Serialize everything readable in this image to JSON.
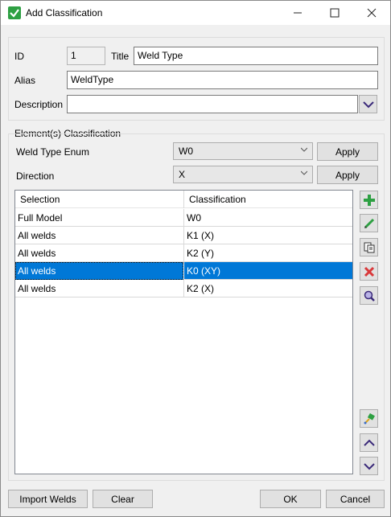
{
  "window": {
    "title": "Add Classification",
    "minimize_glyph": "—",
    "maximize_glyph": "☐",
    "close_glyph": "✕"
  },
  "header": {
    "id_label": "ID",
    "id_value": "1",
    "title_label": "Title",
    "title_value": "Weld Type",
    "alias_label": "Alias",
    "alias_value": "WeldType",
    "description_label": "Description",
    "description_value": ""
  },
  "classification": {
    "group_label": "Element(s) Classification",
    "enum_label": "Weld Type Enum",
    "enum_value": "W0",
    "direction_label": "Direction",
    "direction_value": "X",
    "apply_label": "Apply"
  },
  "table": {
    "columns": [
      "Selection",
      "Classification"
    ],
    "rows": [
      {
        "selection": "Full Model",
        "classification": "W0"
      },
      {
        "selection": "All welds",
        "classification": "K1 (X)"
      },
      {
        "selection": "All welds",
        "classification": "K2 (Y)"
      },
      {
        "selection": "All welds",
        "classification": "K0 (XY)"
      },
      {
        "selection": "All welds",
        "classification": "K2 (X)"
      }
    ],
    "selected_index": 3
  },
  "side_tools": [
    "add-icon",
    "edit-icon",
    "copy-icon",
    "delete-icon",
    "zoom-icon",
    "paint-icon",
    "move-up-icon",
    "move-down-icon"
  ],
  "footer": {
    "import_label": "Import Welds",
    "clear_label": "Clear",
    "ok_label": "OK",
    "cancel_label": "Cancel"
  },
  "colors": {
    "selection": "#0078d7",
    "accent_green": "#2ea043",
    "delete_red": "#d9383a",
    "chevron_purple": "#3b2a7a"
  }
}
